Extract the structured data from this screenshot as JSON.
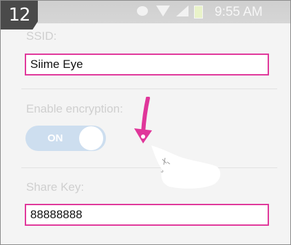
{
  "step": {
    "number": "12"
  },
  "status_bar": {
    "time": "9:55 AM",
    "icons": [
      "alarm-icon",
      "wifi-icon",
      "signal-icon",
      "battery-icon"
    ]
  },
  "ssid": {
    "label": "SSID:",
    "value": "Siime Eye"
  },
  "encryption": {
    "label": "Enable encryption:",
    "state": "ON"
  },
  "share_key": {
    "label": "Share Key:",
    "value": "88888888"
  },
  "colors": {
    "highlight": "#e0369a",
    "toggle": "#cddeef",
    "label": "#cfcfcf"
  }
}
